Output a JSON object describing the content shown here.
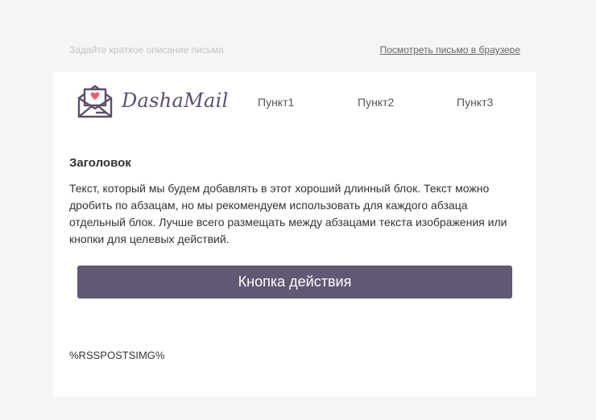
{
  "preheader": {
    "description": "Задайте краткое описание письма",
    "browser_link": "Посмотреть письмо в браузере"
  },
  "header": {
    "logo_text": "DashaMail",
    "logo_icon": "envelope-heart-icon",
    "nav": [
      {
        "label": "Пункт1"
      },
      {
        "label": "Пункт2"
      },
      {
        "label": "Пункт3"
      }
    ]
  },
  "content": {
    "heading": "Заголовок",
    "body": "Текст, который мы будем добавлять в этот хороший длинный блок. Текст можно дробить по абзацам, но мы рекомендуем использовать для каждого абзаца отдельный блок. Лучше всего размещать между абзацами текста изображения или кнопки для целевых действий.",
    "button_label": "Кнопка действия",
    "rss_placeholder": "%RSSPOSTSIMG%"
  },
  "colors": {
    "page_background": "#f5f5f5",
    "card_background": "#ffffff",
    "button": "#625873",
    "brand_text": "#5b4f6b",
    "heart": "#e8606b"
  }
}
